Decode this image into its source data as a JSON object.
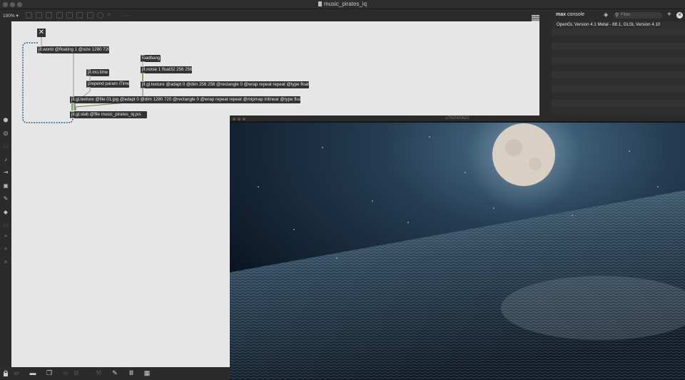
{
  "window": {
    "title": "music_pirates_iq"
  },
  "toolbar": {
    "zoom": "100%",
    "zoom_arrow": "▾"
  },
  "patch": {
    "objects": {
      "world": "jit.world @floating 1 @size 1280 720",
      "mo_time": "jit.mo.time",
      "prepend": "prepend param iTime",
      "loadbang": "loadbang",
      "noise": "jit.noise 1 float32 256 256",
      "texture_noise": "jit.gl.texture @adapt 0 @dim 256 256 @rectangle 0 @wrap repeat repeat @type float32",
      "texture_file": "jit.gl.texture @file 01.jpg @adapt 0 @dim 1280 720 @rectangle 0 @wrap repeat repeat @mipmap trilinear @type float32",
      "slab": "jit.gl.slab @file music_pirates_iq.jxs"
    },
    "close_glyph": "✕"
  },
  "console": {
    "title_bold": "max",
    "title_rest": " console",
    "filter_placeholder": "Filter",
    "message": "OpenGL Version 4.1 Metal - 88.1, GLSL Version 4.10"
  },
  "render_window": {
    "title": "u792000822"
  },
  "colors": {
    "canvas": "#e6e6e6",
    "object": "#333333",
    "console_bg": "#2d2d2d",
    "patch_cord": "#9a9a9a",
    "selection_dash": "#3d5a8a"
  }
}
